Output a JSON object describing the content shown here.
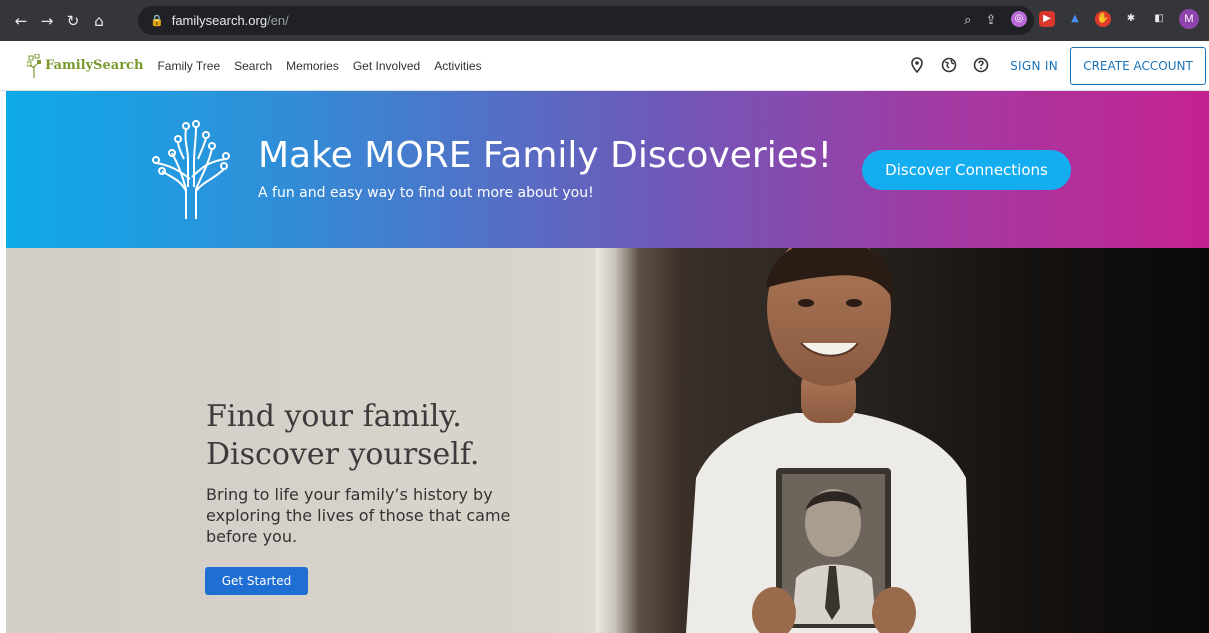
{
  "browser": {
    "url_host": "familysearch.org",
    "url_path": "/en/",
    "avatar_letter": "M"
  },
  "header": {
    "logo_text": "FamilySearch",
    "nav": [
      "Family Tree",
      "Search",
      "Memories",
      "Get Involved",
      "Activities"
    ],
    "sign_in": "SIGN IN",
    "create_account": "CREATE ACCOUNT"
  },
  "banner": {
    "title": "Make MORE Family Discoveries!",
    "subtitle": "A fun and easy way to find out more about you!",
    "button": "Discover Connections"
  },
  "hero": {
    "title_line1": "Find your family.",
    "title_line2": "Discover yourself.",
    "description": "Bring to life your family’s history by exploring the lives of those that came before you.",
    "button": "Get Started"
  },
  "colors": {
    "brand_green": "#7a9a2e",
    "link_blue": "#1a73b8",
    "cta_blue": "#1f6ed4"
  }
}
